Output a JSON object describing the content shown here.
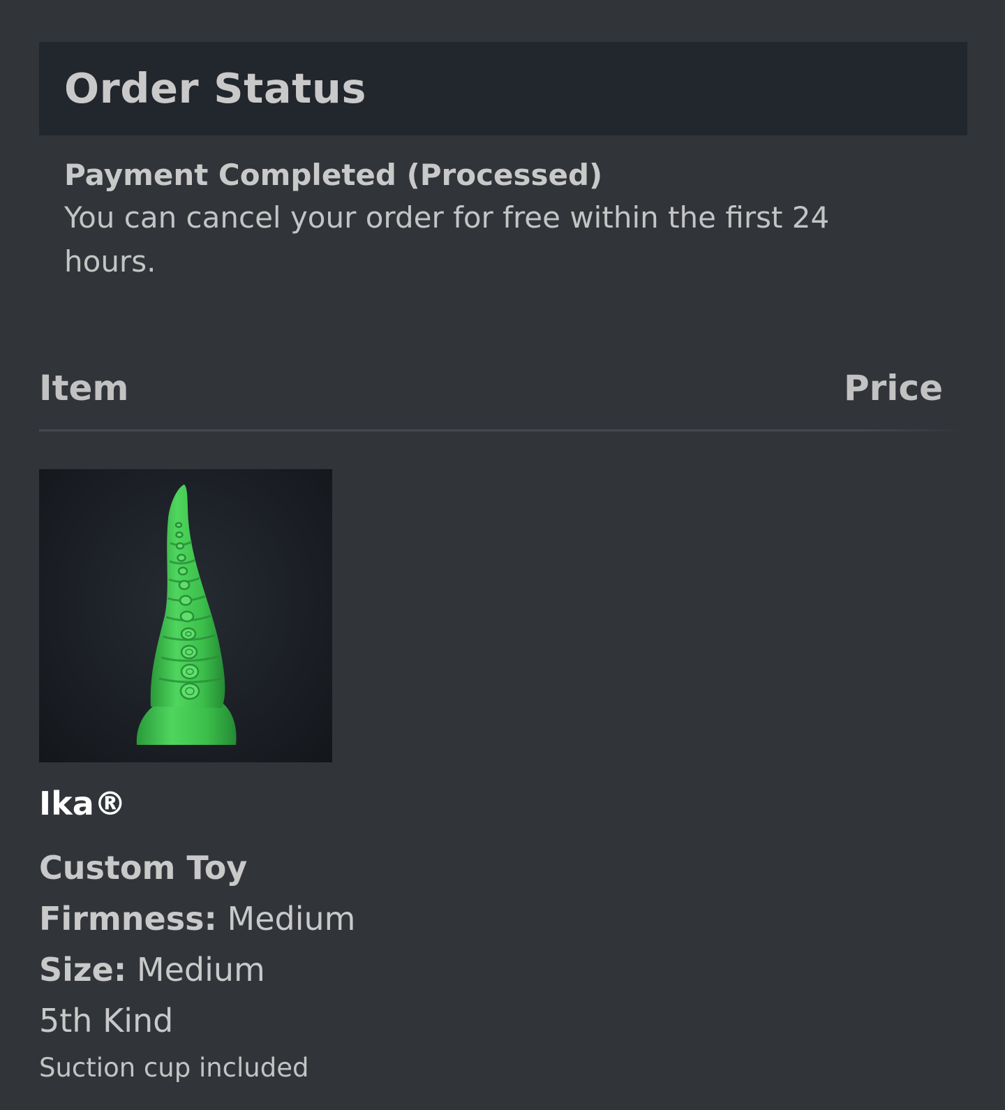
{
  "header": {
    "title": "Order Status"
  },
  "status": {
    "heading": "Payment Completed (Processed)",
    "message": "You can cancel your order for free within the first 24 hours."
  },
  "table": {
    "columns": [
      "Item",
      "Price"
    ]
  },
  "item": {
    "image_description": "green-tentacle-product-image",
    "name": "Ika®",
    "type": "Custom Toy",
    "options": [
      {
        "label": "Firmness:",
        "value": "Medium"
      },
      {
        "label": "Size:",
        "value": "Medium"
      }
    ],
    "variant": "5th Kind",
    "note": "Suction cup included"
  },
  "colors": {
    "background": "#31353a",
    "header_bar": "#22262d",
    "text": "#c9c9c9",
    "product_name": "#ffffff",
    "product_green": "#3ec44f"
  }
}
